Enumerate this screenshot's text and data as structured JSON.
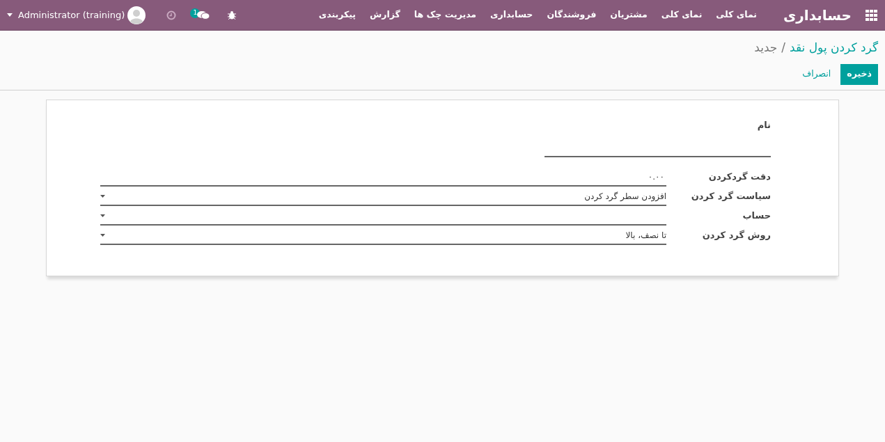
{
  "navbar": {
    "app_title": "حسابداری",
    "menu": [
      "نمای کلی",
      "نمای کلی",
      "مشتریان",
      "فروشندگان",
      "حسابداری",
      "مدیریت چک ها",
      "گزارش",
      "پیکربندی"
    ],
    "message_count": "1",
    "user": "Administrator (training)"
  },
  "breadcrumb": {
    "parent": "گرد کردن پول نقد",
    "separator": "/",
    "current": "جدید"
  },
  "buttons": {
    "save": "ذخیره",
    "discard": "انصراف"
  },
  "form": {
    "name_label": "نام",
    "fields": [
      {
        "kind": "input",
        "label": "دقت گردکردن",
        "value": "۰.۰۰"
      },
      {
        "kind": "select",
        "label": "سیاست گرد کردن",
        "value": "افزودن سطر گرد کردن"
      },
      {
        "kind": "select",
        "label": "حساب"
      },
      {
        "kind": "select",
        "label": "روش گرد کردن",
        "value": "تا نصف، بالا"
      }
    ]
  }
}
